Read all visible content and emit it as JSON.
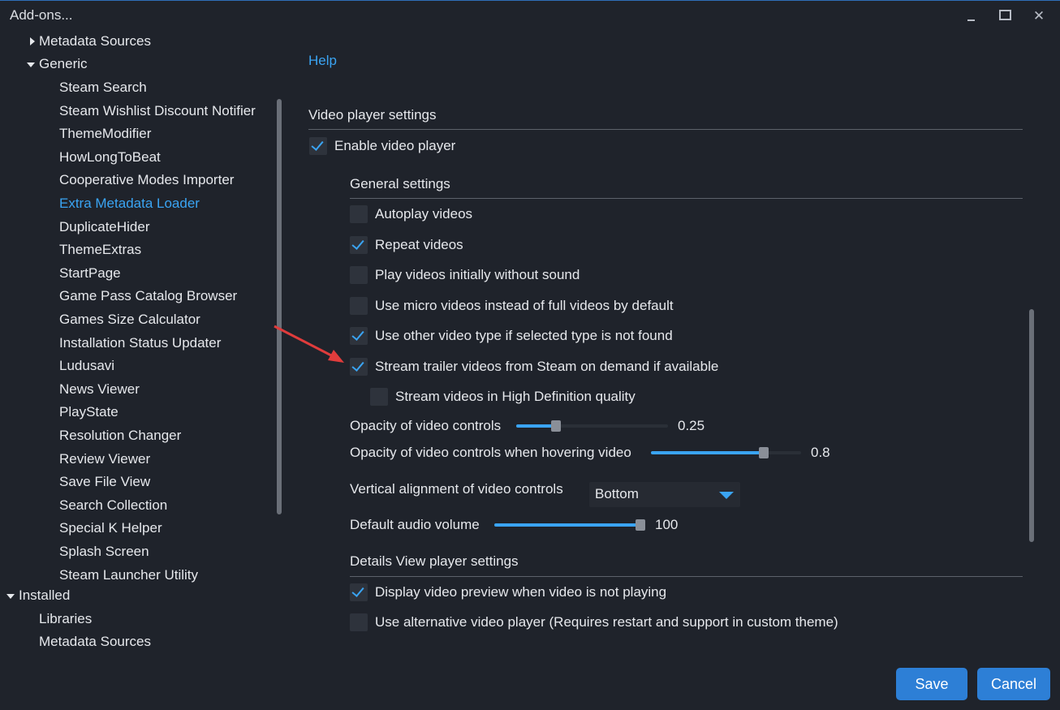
{
  "window": {
    "title": "Add-ons...",
    "minimize_icon": "minimize-icon",
    "maximize_icon": "maximize-icon",
    "close_icon": "close-icon"
  },
  "tree": {
    "metadata_sources_group": "Metadata Sources",
    "generic_group": "Generic",
    "generic_items": [
      "Steam Search",
      "Steam Wishlist Discount Notifier",
      "ThemeModifier",
      "HowLongToBeat",
      "Cooperative Modes Importer",
      "Extra Metadata Loader",
      "DuplicateHider",
      "ThemeExtras",
      "StartPage",
      "Game Pass Catalog Browser",
      "Games Size Calculator",
      "Installation Status Updater",
      "Ludusavi",
      "News Viewer",
      "PlayState",
      "Resolution Changer",
      "Review Viewer",
      "Save File View",
      "Search Collection",
      "Special K Helper",
      "Splash Screen",
      "Steam Launcher Utility"
    ],
    "selected_item": "Extra Metadata Loader",
    "installed_group": "Installed",
    "installed_items": [
      "Libraries",
      "Metadata Sources"
    ]
  },
  "content": {
    "help_link": "Help",
    "video_player_section": "Video player settings",
    "enable_video_player": {
      "label": "Enable video player",
      "checked": true
    },
    "general_settings_title": "General settings",
    "general_options": [
      {
        "label": "Autoplay videos",
        "checked": false
      },
      {
        "label": "Repeat videos",
        "checked": true
      },
      {
        "label": "Play videos initially without sound",
        "checked": false
      },
      {
        "label": "Use micro videos instead of full videos by default",
        "checked": false
      },
      {
        "label": "Use other video type if selected type is not found",
        "checked": true
      },
      {
        "label": "Stream trailer videos from Steam on demand if available",
        "checked": true
      }
    ],
    "stream_hd": {
      "label": "Stream videos in High Definition quality",
      "checked": false
    },
    "opacity_controls": {
      "label": "Opacity of video controls",
      "value": "0.25",
      "level": 0.25
    },
    "opacity_hover": {
      "label": "Opacity of video controls when hovering video",
      "value": "0.8",
      "level": 0.8
    },
    "vertical_alignment": {
      "label": "Vertical alignment of video controls",
      "selected": "Bottom"
    },
    "audio_volume": {
      "label": "Default audio volume",
      "value": "100",
      "level": 1.0
    },
    "details_view_title": "Details View player settings",
    "details_options": [
      {
        "label": "Display video preview when video is not playing",
        "checked": true
      },
      {
        "label": "Use alternative video player (Requires restart and support in custom theme)",
        "checked": false
      }
    ]
  },
  "buttons": {
    "save": "Save",
    "cancel": "Cancel"
  },
  "colors": {
    "accent": "#3aa4f3",
    "background": "#1f232b",
    "button": "#2d7fd6",
    "annotation_arrow": "#e03c3c"
  }
}
